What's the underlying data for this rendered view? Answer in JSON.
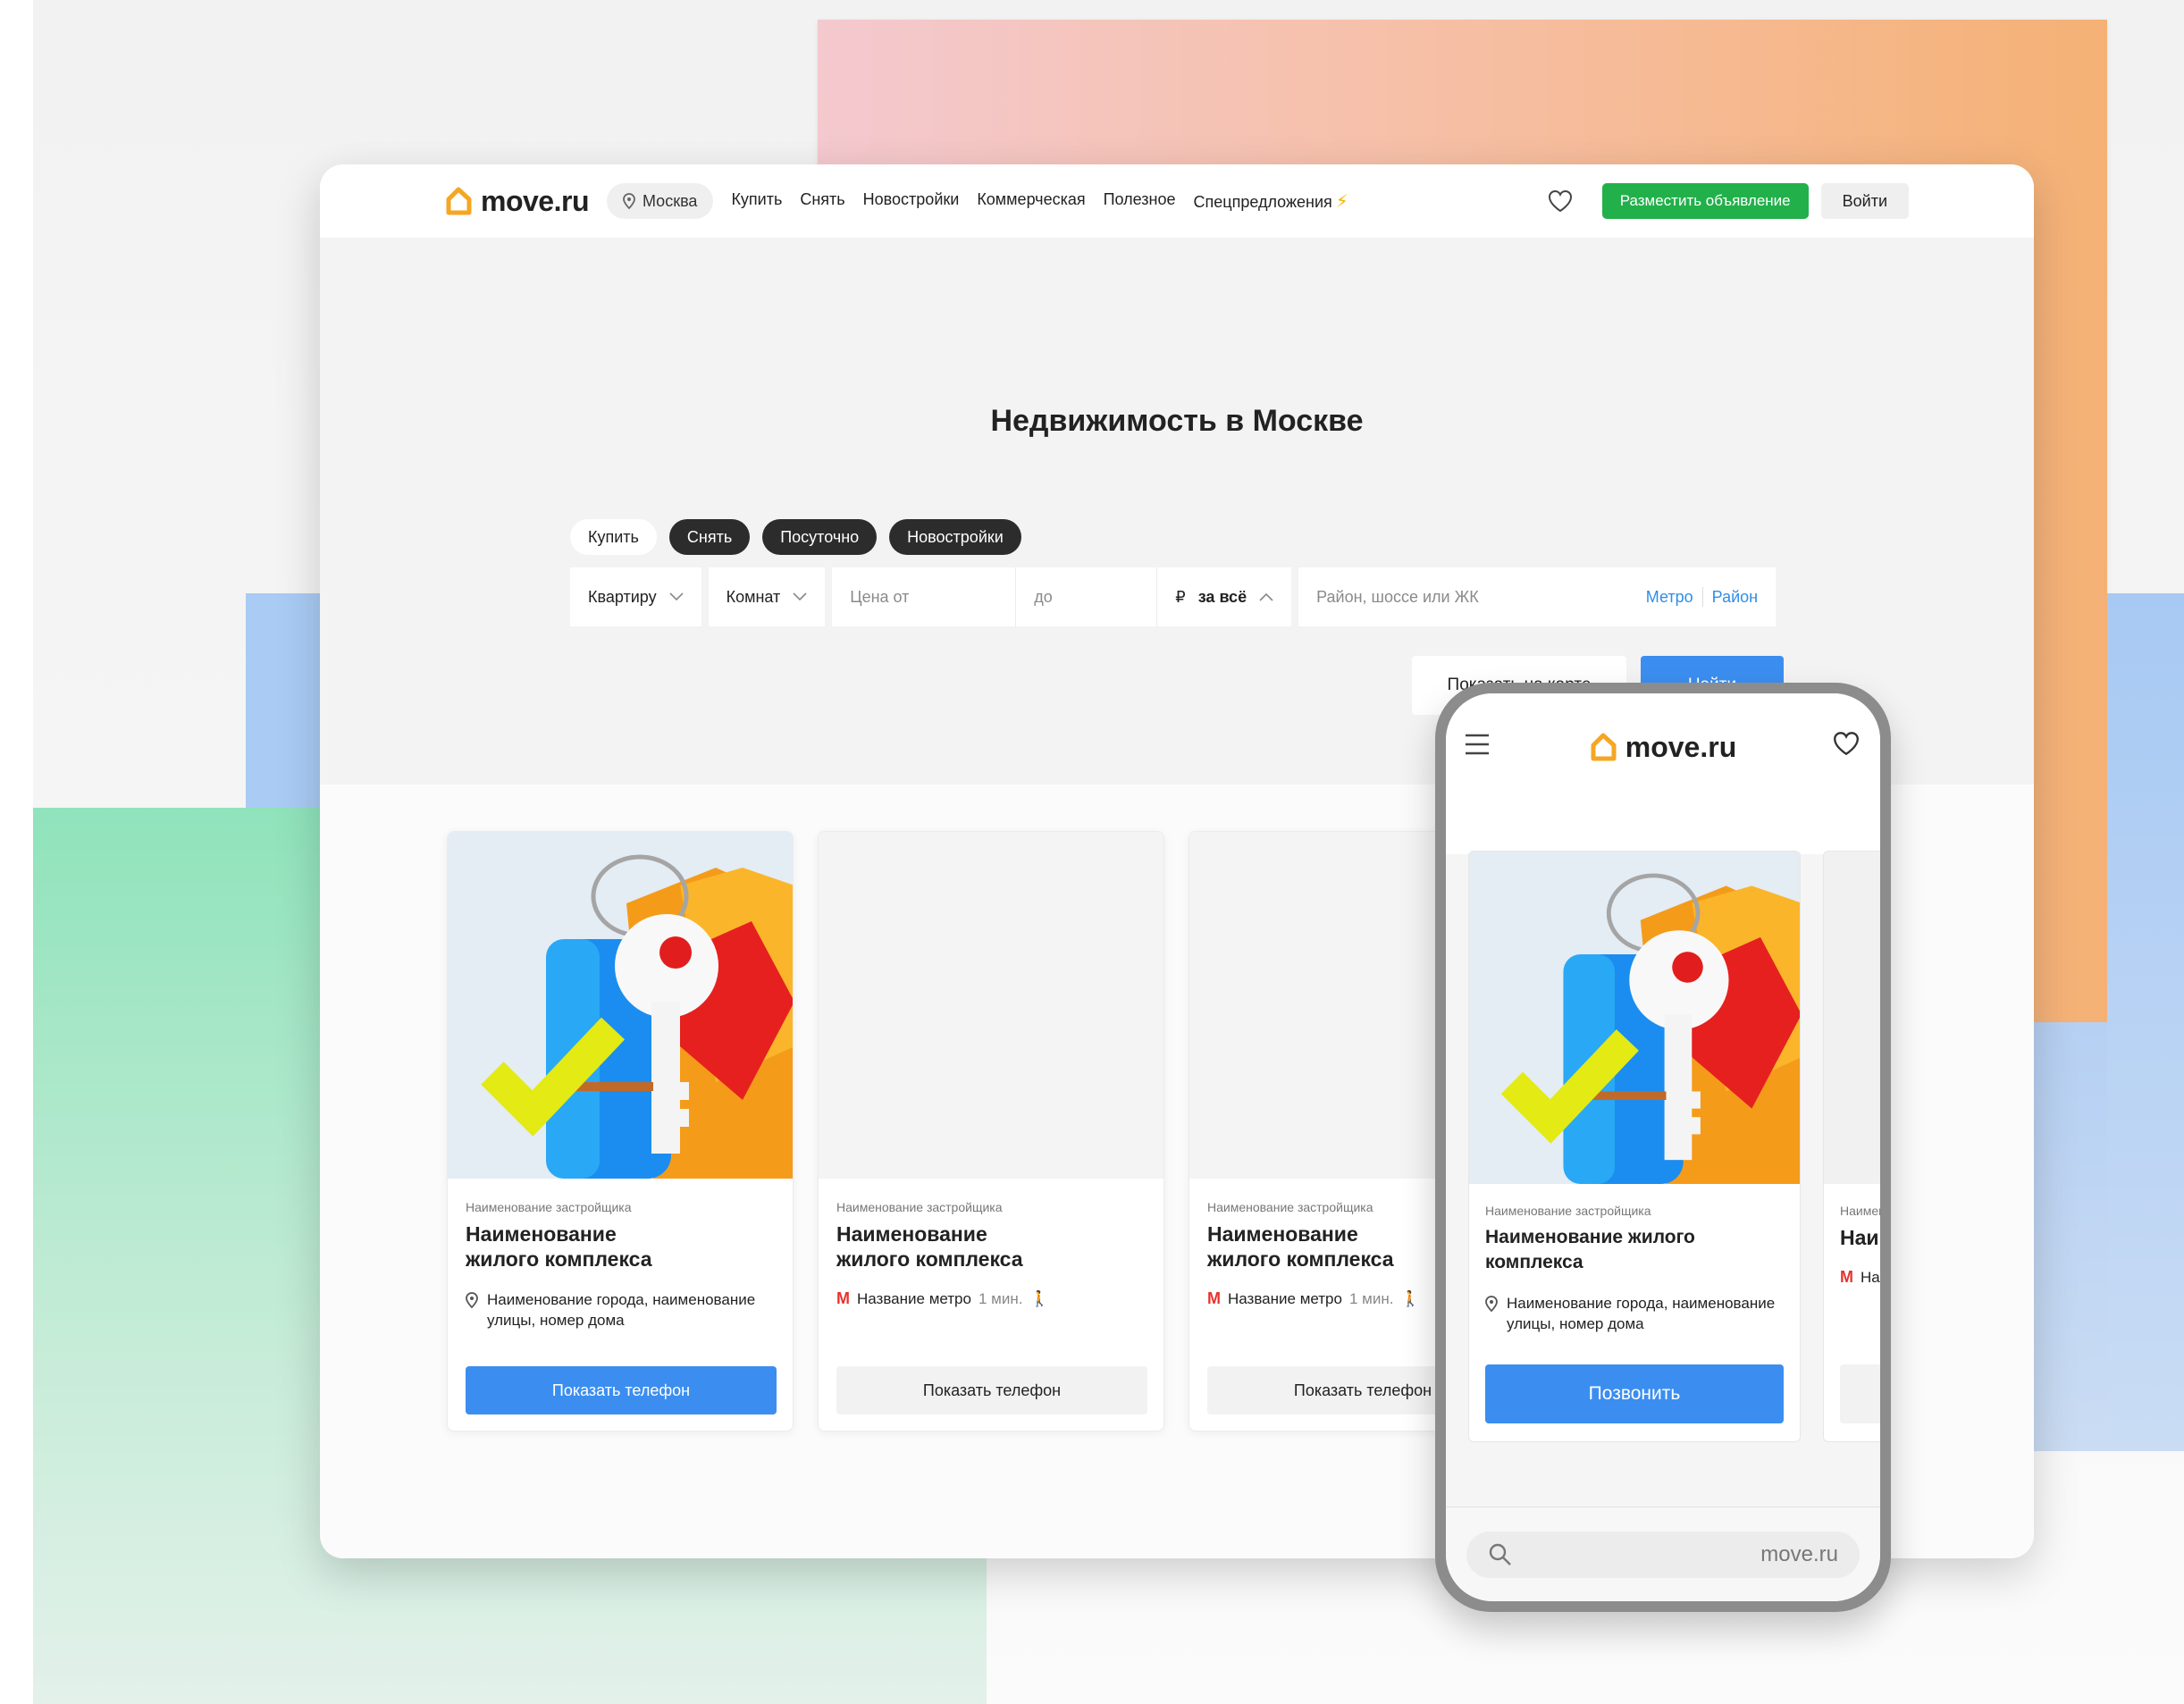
{
  "colors": {
    "brand_orange": "#f5a623",
    "primary_blue": "#3b8ef0",
    "post_green": "#22b04b",
    "metro_red": "#e8322d",
    "chip_dark": "#2c2c2c"
  },
  "header": {
    "logo_text": "move.ru",
    "city": "Москва",
    "nav": [
      "Купить",
      "Снять",
      "Новостройки",
      "Коммерческая",
      "Полезное",
      "Спецпредложения"
    ],
    "favorites_icon": "heart-icon",
    "post_button": "Разместить объявление",
    "login_button": "Войти"
  },
  "hero": {
    "title": "Недвижимость в Москве",
    "chips": [
      {
        "label": "Купить",
        "selected": false
      },
      {
        "label": "Снять",
        "selected": true
      },
      {
        "label": "Посуточно",
        "selected": true
      },
      {
        "label": "Новостройки",
        "selected": true
      }
    ],
    "filters": {
      "type_value": "Квартиру",
      "rooms_value": "Комнат",
      "price_from_placeholder": "Цена от",
      "price_to_placeholder": "до",
      "currency": "₽",
      "price_mode": "за всё",
      "location_placeholder": "Район, шоссе или ЖК",
      "metro_link": "Метро",
      "district_link": "Район"
    },
    "show_on_map": "Показать на карте",
    "find": "Найти"
  },
  "cards": [
    {
      "developer": "Наименование застройщика",
      "complex": "Наименование жилого комплекса",
      "address": "Наименование города, наименование улицы, номер дома",
      "button": "Показать телефон"
    },
    {
      "developer": "Наименование застройщика",
      "complex": "Наименование жилого комплекса",
      "metro": "Название метро",
      "metro_time": "1 мин.",
      "button": "Показать телефон"
    },
    {
      "developer": "Наименование застройщика",
      "complex": "Наименование жилого комплекса",
      "metro": "Название метро",
      "metro_time": "1 мин.",
      "button": "Показать телефон"
    }
  ],
  "mobile": {
    "logo_text": "move.ru",
    "card": {
      "developer": "Наименование застройщика",
      "complex": "Наименование жилого комплекса",
      "address": "Наименование города, наименование улицы, номер дома",
      "button": "Позвонить"
    },
    "card2": {
      "developer": "Наименование застройщика",
      "complex": "Наименование жилого комплекса",
      "metro": "Название метро"
    },
    "url": "move.ru"
  }
}
